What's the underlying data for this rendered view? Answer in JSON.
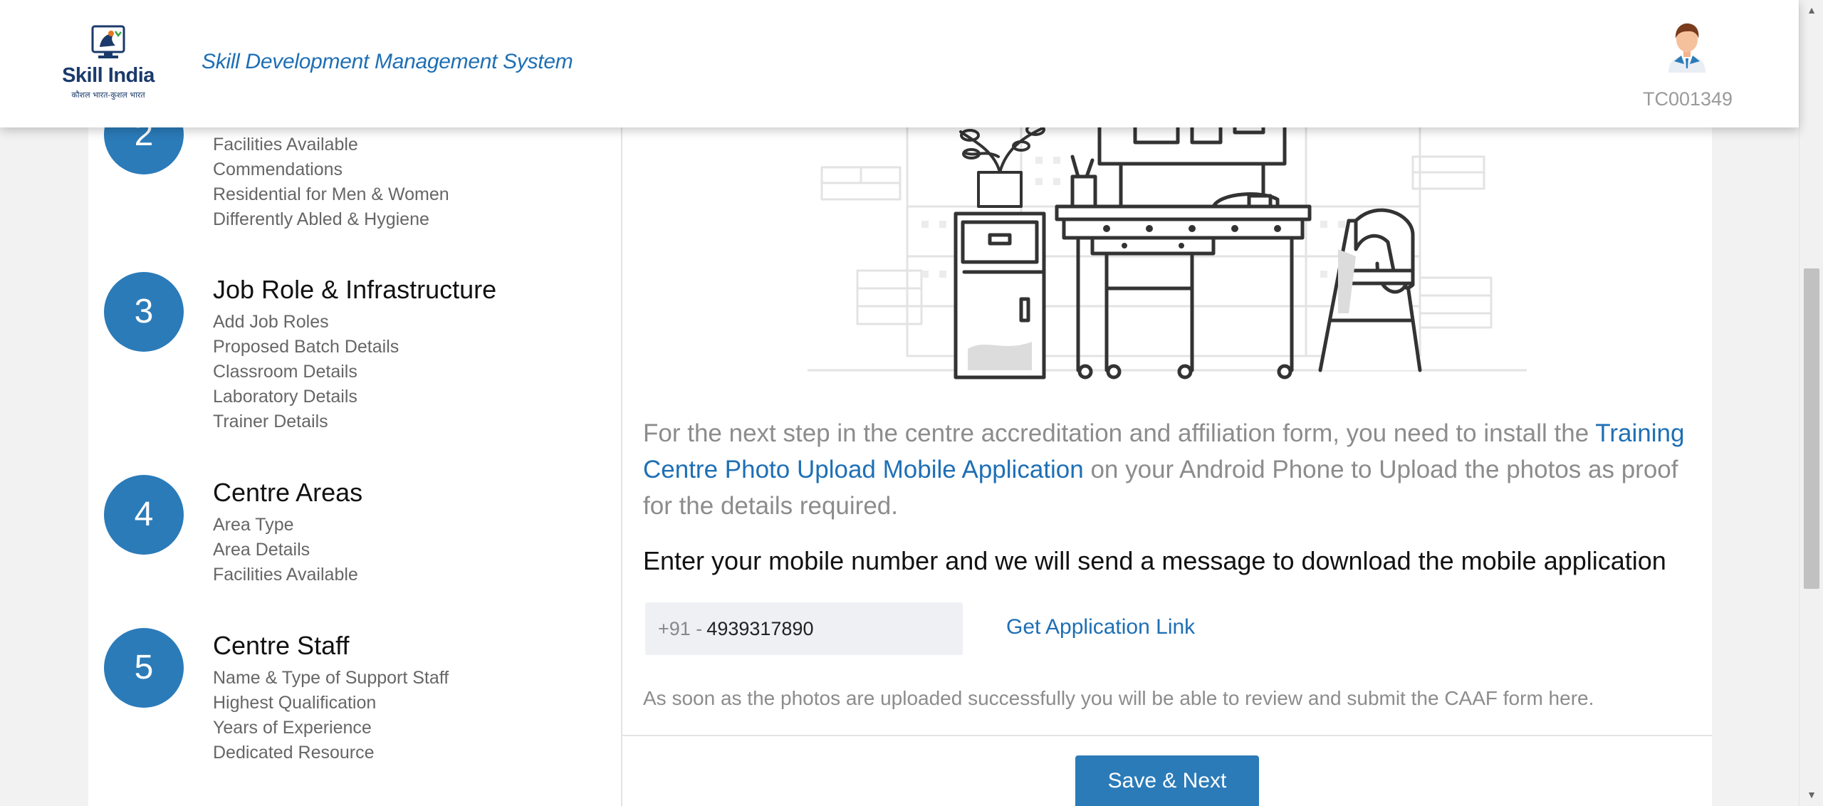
{
  "header": {
    "logo_brand": "Skill India",
    "logo_tagline": "कौशल भारत-कुशल भारत",
    "app_title": "Skill Development Management System",
    "user_id": "TC001349"
  },
  "steps": [
    {
      "number": "2",
      "title": "",
      "items": [
        "Facilities Available",
        "Commendations",
        "Residential for Men & Women",
        "Differently Abled & Hygiene"
      ]
    },
    {
      "number": "3",
      "title": "Job Role & Infrastructure",
      "items": [
        "Add Job Roles",
        "Proposed Batch Details",
        "Classroom Details",
        "Laboratory Details",
        "Trainer Details"
      ]
    },
    {
      "number": "4",
      "title": "Centre Areas",
      "items": [
        "Area Type",
        "Area Details",
        "Facilities Available"
      ]
    },
    {
      "number": "5",
      "title": "Centre Staff",
      "items": [
        "Name & Type of Support Staff",
        "Highest Qualification",
        "Years of Experience",
        "Dedicated Resource"
      ]
    }
  ],
  "main": {
    "info_before": "For the next step in the centre accreditation and affiliation form, you need to install the ",
    "info_link": "Training Centre Photo Upload Mobile Application",
    "info_after": " on your Android Phone to Upload the photos as proof for the details required.",
    "enter_text": "Enter your mobile number and we will send a message to download the mobile application",
    "phone_prefix": "+91 -",
    "phone_value": "4939317890",
    "get_link_label": "Get Application Link",
    "note_text": "As soon as the photos are uploaded successfully you will be able to review and submit the CAAF form here.",
    "save_label": "Save & Next"
  },
  "colors": {
    "accent": "#2b7bb9",
    "link": "#1e6fb5",
    "muted_text": "#8c8c8c",
    "page_bg": "#f2f2f2"
  }
}
